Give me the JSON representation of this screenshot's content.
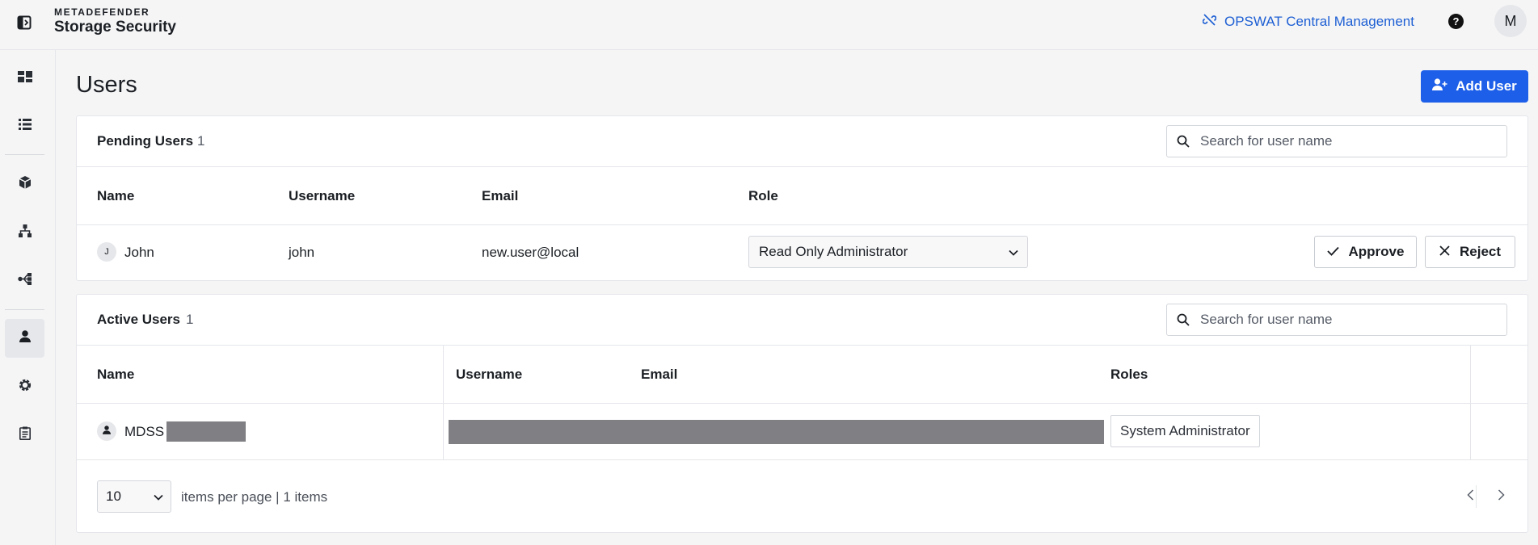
{
  "header": {
    "brand_top": "METADEFENDER",
    "brand_bottom": "Storage Security",
    "central_link": "OPSWAT Central Management",
    "help_glyph": "?",
    "avatar_initial": "M"
  },
  "sidebar": {
    "items": [
      {
        "icon": "dashboard-icon"
      },
      {
        "icon": "list-icon"
      },
      {
        "icon": "cube-icon"
      },
      {
        "icon": "hierarchy-icon"
      },
      {
        "icon": "workflow-icon"
      },
      {
        "icon": "user-icon",
        "active": true
      },
      {
        "icon": "gear-icon"
      },
      {
        "icon": "clipboard-icon"
      }
    ]
  },
  "page": {
    "title": "Users",
    "add_user_label": "Add User"
  },
  "pending": {
    "title": "Pending Users",
    "count": "1",
    "search_placeholder": "Search for user name",
    "columns": {
      "name": "Name",
      "username": "Username",
      "email": "Email",
      "role": "Role"
    },
    "rows": [
      {
        "initial": "J",
        "name": "John",
        "username": "john",
        "email": "new.user@local",
        "role": "Read Only Administrator"
      }
    ],
    "approve_label": "Approve",
    "reject_label": "Reject"
  },
  "active": {
    "title": "Active Users",
    "count": "1",
    "search_placeholder": "Search for user name",
    "columns": {
      "name": "Name",
      "username": "Username",
      "email": "Email",
      "roles": "Roles"
    },
    "rows": [
      {
        "name": "MDSS",
        "role": "System Administrator"
      }
    ]
  },
  "pagination": {
    "per_page": "10",
    "summary": "items per page | 1 items"
  },
  "colors": {
    "accent": "#1d5fe8",
    "link": "#1d5fd3"
  }
}
